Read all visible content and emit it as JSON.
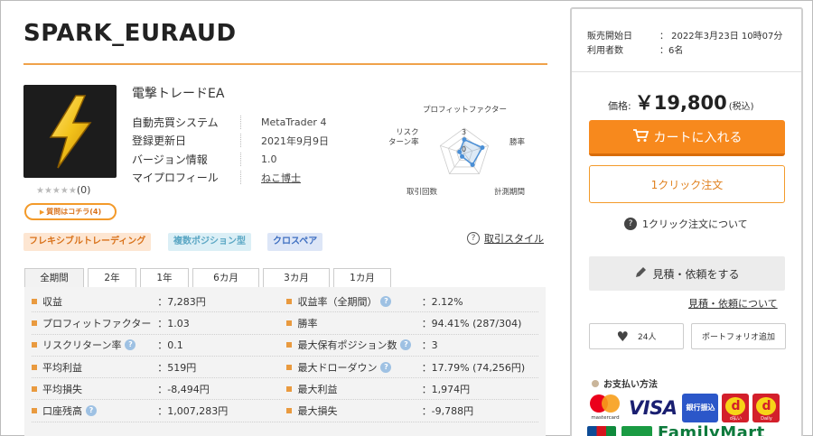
{
  "product": {
    "title": "SPARK_EURAUD",
    "name": "電撃トレードEA",
    "rating": {
      "stars": "★★★★★",
      "count": "(0)"
    },
    "qa_button": "質問はコチラ(4)",
    "info": [
      {
        "label": "自動売買システム",
        "value": "MetaTrader 4"
      },
      {
        "label": "登録更新日",
        "value": "2021年9月9日"
      },
      {
        "label": "バージョン情報",
        "value": "1.0"
      },
      {
        "label": "マイプロフィール",
        "value": "ねこ博士"
      }
    ]
  },
  "radar": {
    "labels": {
      "pf": "プロフィットファクター",
      "winrate": "勝率",
      "period": "計測期間",
      "count": "取引回数",
      "risk": "リスク\nターン率"
    },
    "scale_labels": [
      "3",
      "0"
    ],
    "values": [
      0.55,
      0.75,
      0.55,
      0.15,
      0.2
    ]
  },
  "tags": [
    "フレキシブルトレーディング",
    "複数ポジション型",
    "クロスペア"
  ],
  "trade_style": "取引スタイル",
  "tabs": [
    "全期間",
    "2年",
    "1年",
    "6カ月",
    "3カ月",
    "1カ月"
  ],
  "stats": [
    {
      "l1": "収益",
      "h1": false,
      "v1": "：7,283円",
      "l2": "収益率（全期間）",
      "h2": true,
      "v2": "：2.12%"
    },
    {
      "l1": "プロフィットファクター",
      "h1": false,
      "v1": "：1.03",
      "l2": "勝率",
      "h2": false,
      "v2": "：94.41% (287/304)"
    },
    {
      "l1": "リスクリターン率",
      "h1": true,
      "v1": "：0.1",
      "l2": "最大保有ポジション数",
      "h2": true,
      "v2": "：3"
    },
    {
      "l1": "平均利益",
      "h1": false,
      "v1": "：519円",
      "l2": "最大ドローダウン",
      "h2": true,
      "v2": "：17.79% (74,256円)"
    },
    {
      "l1": "平均損失",
      "h1": false,
      "v1": "：-8,494円",
      "l2": "最大利益",
      "h2": false,
      "v2": "：1,974円"
    },
    {
      "l1": "口座残高",
      "h1": true,
      "v1": "：1,007,283円",
      "l2": "最大損失",
      "h2": false,
      "v2": "：-9,788円"
    }
  ],
  "panel": {
    "sale_start_label": "販売開始日",
    "sale_start_value": "：  2022年3月23日 10時07分",
    "users_label": "利用者数",
    "users_value": "：6名",
    "price_label": "価格:",
    "price_amount": "￥19,800",
    "price_tax": "(税込)",
    "cart_button": "カートに入れる",
    "oneclick_button": "1クリック注文",
    "oneclick_about": "1クリック注文について",
    "quote_button": "見積・依頼をする",
    "quote_link": "見積・依頼について",
    "like_count": "24人",
    "portfolio_button": "ポートフォリオ追加",
    "payment_title": "お支払い方法",
    "mastercard_text": "mastercard",
    "visa_text": "VISA",
    "bank_text": "銀行振込",
    "dpay_text": "d払い",
    "daily_text": "Daily",
    "famima_text": "FamilyMart"
  }
}
